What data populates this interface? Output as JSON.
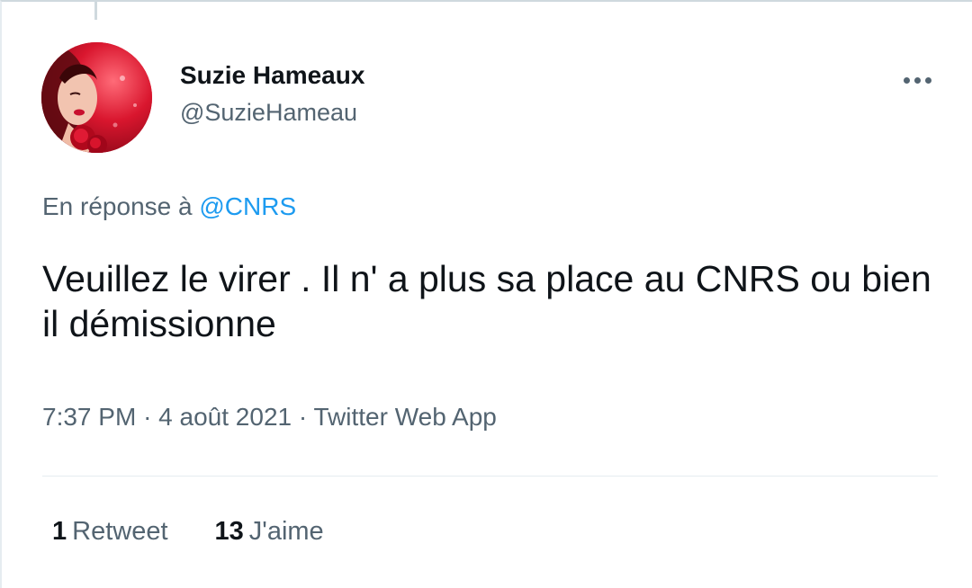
{
  "tweet": {
    "author": {
      "name": "Suzie Hameaux",
      "handle": "@SuzieHameau"
    },
    "reply": {
      "prefix": "En réponse à",
      "mention": "@CNRS"
    },
    "text": "Veuillez le virer . Il n' a plus sa place au CNRS ou bien il démissionne",
    "time": "7:37 PM",
    "date": "4 août 2021",
    "source": "Twitter Web App",
    "separator": "·",
    "stats": {
      "retweets_count": "1",
      "retweets_label": "Retweet",
      "likes_count": "13",
      "likes_label": "J'aime"
    }
  },
  "icons": {
    "more": "more-horizontal-icon"
  },
  "colors": {
    "text": "#0f1419",
    "secondary": "#536471",
    "link": "#1d9bf0",
    "divider": "#e6ecf0"
  }
}
